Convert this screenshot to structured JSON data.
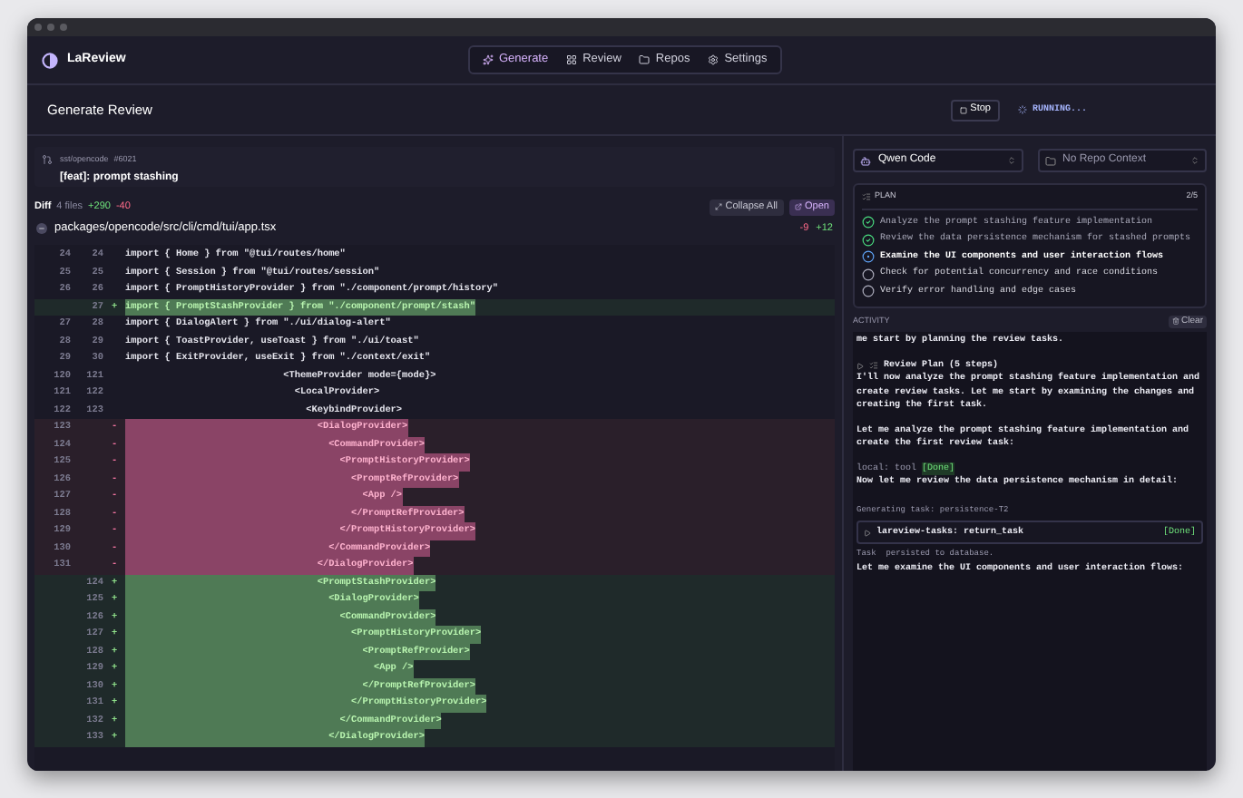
{
  "app": {
    "name": "LaReview"
  },
  "nav": [
    {
      "label": "Generate",
      "selected": true
    },
    {
      "label": "Review",
      "selected": false
    },
    {
      "label": "Repos",
      "selected": false
    },
    {
      "label": "Settings",
      "selected": false
    }
  ],
  "header": {
    "title": "Generate Review",
    "stop_label": "Stop",
    "status": "RUNNING..."
  },
  "pr": {
    "repo": "sst/opencode",
    "number": "#6021",
    "title": "[feat]: prompt stashing"
  },
  "diff": {
    "label": "Diff",
    "files": "4 files",
    "added": "+290",
    "removed": "-40",
    "collapse_label": "Collapse All",
    "open_label": "Open"
  },
  "file": {
    "path": "packages/opencode/src/cli/cmd/tui/app.tsx",
    "removed": "-9",
    "added": "+12"
  },
  "lines": [
    {
      "old": "24",
      "new": "24",
      "kind": "context",
      "text": "import { Home } from \"@tui/routes/home\""
    },
    {
      "old": "25",
      "new": "25",
      "kind": "context",
      "text": "import { Session } from \"@tui/routes/session\""
    },
    {
      "old": "26",
      "new": "26",
      "kind": "context",
      "text": "import { PromptHistoryProvider } from \"./component/prompt/history\""
    },
    {
      "new": "27",
      "kind": "add",
      "sign": "+",
      "text": "import { PromptStashProvider } from \"./component/prompt/stash\""
    },
    {
      "old": "27",
      "new": "28",
      "kind": "context",
      "text": "import { DialogAlert } from \"./ui/dialog-alert\""
    },
    {
      "old": "28",
      "new": "29",
      "kind": "context",
      "text": "import { ToastProvider, useToast } from \"./ui/toast\""
    },
    {
      "old": "29",
      "new": "30",
      "kind": "context",
      "text": "import { ExitProvider, useExit } from \"./context/exit\""
    },
    {
      "old": "120",
      "new": "121",
      "kind": "context",
      "text": "                            <ThemeProvider mode={mode}>"
    },
    {
      "old": "121",
      "new": "122",
      "kind": "context",
      "text": "                              <LocalProvider>"
    },
    {
      "old": "122",
      "new": "123",
      "kind": "context",
      "text": "                                <KeybindProvider>"
    },
    {
      "old": "123",
      "kind": "del",
      "sign": "-",
      "text": "                                  <DialogProvider>"
    },
    {
      "old": "124",
      "kind": "del",
      "sign": "-",
      "text": "                                    <CommandProvider>"
    },
    {
      "old": "125",
      "kind": "del",
      "sign": "-",
      "text": "                                      <PromptHistoryProvider>"
    },
    {
      "old": "126",
      "kind": "del",
      "sign": "-",
      "text": "                                        <PromptRefProvider>"
    },
    {
      "old": "127",
      "kind": "del",
      "sign": "-",
      "text": "                                          <App />"
    },
    {
      "old": "128",
      "kind": "del",
      "sign": "-",
      "text": "                                        </PromptRefProvider>"
    },
    {
      "old": "129",
      "kind": "del",
      "sign": "-",
      "text": "                                      </PromptHistoryProvider>"
    },
    {
      "old": "130",
      "kind": "del",
      "sign": "-",
      "text": "                                    </CommandProvider>"
    },
    {
      "old": "131",
      "kind": "del",
      "sign": "-",
      "text": "                                  </DialogProvider>"
    },
    {
      "new": "124",
      "kind": "add",
      "sign": "+",
      "text": "                                  <PromptStashProvider>"
    },
    {
      "new": "125",
      "kind": "add",
      "sign": "+",
      "text": "                                    <DialogProvider>"
    },
    {
      "new": "126",
      "kind": "add",
      "sign": "+",
      "text": "                                      <CommandProvider>"
    },
    {
      "new": "127",
      "kind": "add",
      "sign": "+",
      "text": "                                        <PromptHistoryProvider>"
    },
    {
      "new": "128",
      "kind": "add",
      "sign": "+",
      "text": "                                          <PromptRefProvider>"
    },
    {
      "new": "129",
      "kind": "add",
      "sign": "+",
      "text": "                                            <App />"
    },
    {
      "new": "130",
      "kind": "add",
      "sign": "+",
      "text": "                                          </PromptRefProvider>"
    },
    {
      "new": "131",
      "kind": "add",
      "sign": "+",
      "text": "                                        </PromptHistoryProvider>"
    },
    {
      "new": "132",
      "kind": "add",
      "sign": "+",
      "text": "                                      </CommandProvider>"
    },
    {
      "new": "133",
      "kind": "add",
      "sign": "+",
      "text": "                                    </DialogProvider>"
    }
  ],
  "agent": {
    "value": "Qwen Code"
  },
  "repo_context": {
    "value": "No Repo Context"
  },
  "plan": {
    "title": "PLAN",
    "count": "2/5",
    "steps": [
      {
        "text": "Analyze the prompt stashing feature implementation",
        "kind": "done"
      },
      {
        "text": "Review the data persistence mechanism for stashed prompts",
        "kind": "done"
      },
      {
        "text": "Examine the UI components and user interaction flows",
        "kind": "active"
      },
      {
        "text": "Check for potential concurrency and race conditions",
        "kind": "pending"
      },
      {
        "text": "Verify error handling and edge cases",
        "kind": "pending"
      }
    ]
  },
  "activity": {
    "title": "ACTIVITY",
    "clear_label": "Clear",
    "entries": [
      {
        "kind": "text",
        "text": "me start by planning the review tasks."
      },
      {
        "kind": "plan",
        "text": "Review Plan (5 steps)"
      },
      {
        "kind": "text",
        "text": "I'll now analyze the prompt stashing feature implementation and create review tasks. Let me start by examining the changes and creating the first task."
      },
      {
        "kind": "text",
        "text": "Let me analyze the prompt stashing feature implementation and create the first review task:"
      },
      {
        "kind": "tool",
        "text": "local: tool",
        "badge": "[Done]"
      },
      {
        "kind": "text",
        "text": "Now let me review the data persistence mechanism in detail:"
      },
      {
        "kind": "label",
        "text": "Generating task: persistence-T2"
      },
      {
        "kind": "call",
        "text": "lareview-tasks: return_task",
        "badge": "[Done]"
      },
      {
        "kind": "note",
        "text": "Task  persisted to database."
      },
      {
        "kind": "text",
        "text": "Let me examine the UI components and user interaction flows:"
      }
    ]
  }
}
